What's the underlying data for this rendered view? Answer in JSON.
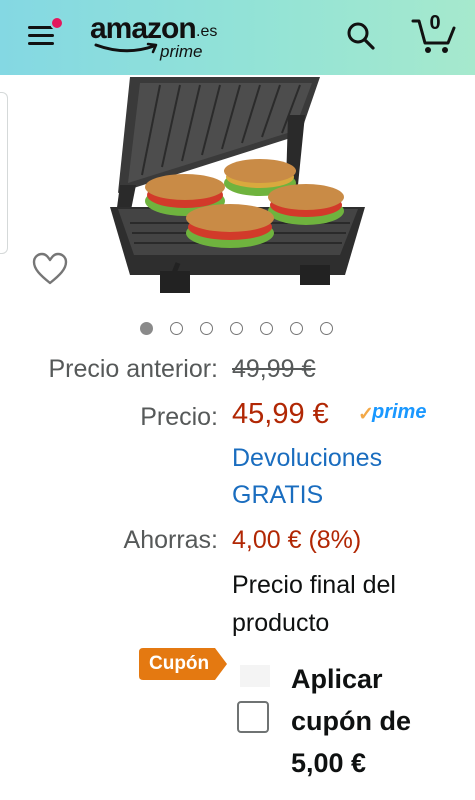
{
  "header": {
    "logo_word": "amazon",
    "logo_tld": ".es",
    "logo_sub": "prime",
    "cart_count": "0",
    "icons": [
      "menu-icon",
      "search-icon",
      "cart-icon"
    ]
  },
  "product": {
    "image": "contact-grill-sandwich-press",
    "carousel": {
      "total": 7,
      "active": 1
    }
  },
  "pricing": {
    "previous_label": "Precio anterior:",
    "previous_value": "49,99 €",
    "price_label": "Precio:",
    "price_value": "45,99 €",
    "prime": "prime",
    "returns_line1": "Devoluciones",
    "returns_line2": "GRATIS",
    "savings_label": "Ahorras:",
    "savings_value": "4,00 € (8%)",
    "final_line1": "Precio final del",
    "final_line2": "producto"
  },
  "coupon": {
    "badge": "Cupón",
    "line1": "Aplicar",
    "line2": "cupón de",
    "line3": "5,00 €",
    "checked": false
  },
  "colors": {
    "header_start": "#84d8e3",
    "header_end": "#a6e9cd",
    "price_red": "#b12704",
    "link_blue": "#1a6dbf",
    "coupon_orange": "#e47911",
    "prime_blue": "#1a98ff"
  }
}
